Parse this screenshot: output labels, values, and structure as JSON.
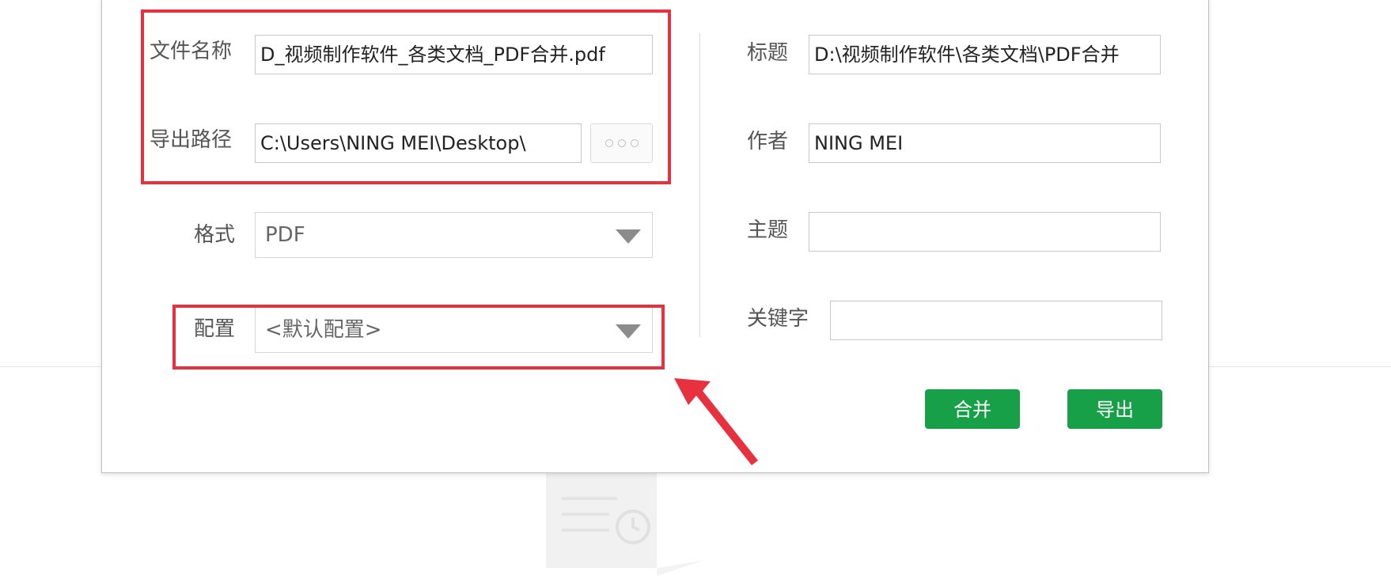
{
  "form": {
    "filename_label": "文件名称",
    "filename_value": "D_视频制作软件_各类文档_PDF合并.pdf",
    "path_label": "导出路径",
    "path_value": "C:\\Users\\NING MEI\\Desktop\\",
    "format_label": "格式",
    "format_value": "PDF",
    "config_label": "配置",
    "config_value": "<默认配置>"
  },
  "meta": {
    "title_label": "标题",
    "title_value": "D:\\视频制作软件\\各类文档\\PDF合并",
    "author_label": "作者",
    "author_value": "NING MEI",
    "subject_label": "主题",
    "subject_value": "",
    "keywords_label": "关键字",
    "keywords_value": ""
  },
  "actions": {
    "merge_label": "合并",
    "export_label": "导出"
  },
  "colors": {
    "accent_green": "#17a047",
    "highlight_red": "#e8313f"
  }
}
